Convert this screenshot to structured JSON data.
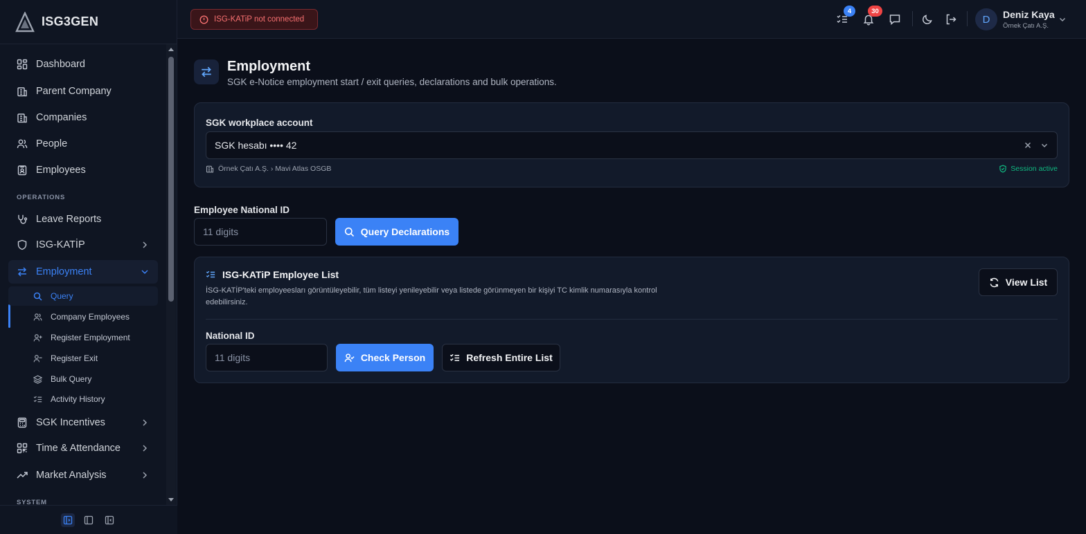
{
  "app": {
    "brand": "ISG3GEN"
  },
  "sidebar": {
    "items": [
      {
        "label": "Dashboard",
        "icon": "grid-icon"
      },
      {
        "label": "Parent Company",
        "icon": "building-icon"
      },
      {
        "label": "Companies",
        "icon": "building-icon"
      },
      {
        "label": "People",
        "icon": "users-icon"
      },
      {
        "label": "Employees",
        "icon": "id-badge-icon"
      }
    ],
    "section_operations": "OPERATIONS",
    "ops_items": [
      {
        "label": "Leave Reports",
        "icon": "stethoscope-icon"
      },
      {
        "label": "ISG-KATİP",
        "icon": "shield-icon"
      },
      {
        "label": "Employment",
        "icon": "arrows-swap-icon"
      }
    ],
    "sub_items": [
      {
        "label": "Query",
        "icon": "search-icon"
      },
      {
        "label": "Company Employees",
        "icon": "users-icon"
      },
      {
        "label": "Register Employment",
        "icon": "user-plus-icon"
      },
      {
        "label": "Register Exit",
        "icon": "user-minus-icon"
      },
      {
        "label": "Bulk Query",
        "icon": "layers-icon"
      },
      {
        "label": "Activity History",
        "icon": "list-check-icon"
      }
    ],
    "more_items": [
      {
        "label": "SGK Incentives",
        "icon": "calculator-icon"
      },
      {
        "label": "Time & Attendance",
        "icon": "qr-icon"
      },
      {
        "label": "Market Analysis",
        "icon": "trend-icon"
      }
    ],
    "section_system": "SYSTEM"
  },
  "topbar": {
    "alert_text": "ISG-KATiP not connected",
    "tasks_count": "4",
    "notifications_count": "30",
    "user_name": "Deniz Kaya",
    "user_company": "Örnek Çatı A.Ş.",
    "avatar_letter": "D"
  },
  "page": {
    "title": "Employment",
    "subtitle": "SGK e-Notice employment start / exit queries, declarations and bulk operations."
  },
  "account": {
    "label": "SGK workplace account",
    "value": "SGK hesabı •••• 42",
    "breadcrumb": "Örnek Çatı A.Ş. › Mavi Atlas OSGB",
    "session": "Session active"
  },
  "declaration": {
    "label": "Employee National ID",
    "placeholder": "11 digits",
    "button": "Query Declarations"
  },
  "katip_list": {
    "title": "ISG-KATiP Employee List",
    "description": "İSG-KATİP'teki employeesları görüntüleyebilir, tüm listeyi yenileyebilir veya listede görünmeyen bir kişiyi TC kimlik numarasıyla kontrol edebilirsiniz.",
    "view_button": "View List",
    "national_id_label": "National ID",
    "placeholder": "11 digits",
    "check_button": "Check Person",
    "refresh_button": "Refresh Entire List"
  },
  "colors": {
    "accent": "#3b82f6",
    "danger": "#f87171",
    "success": "#10b981",
    "background": "#0b0f1a"
  }
}
